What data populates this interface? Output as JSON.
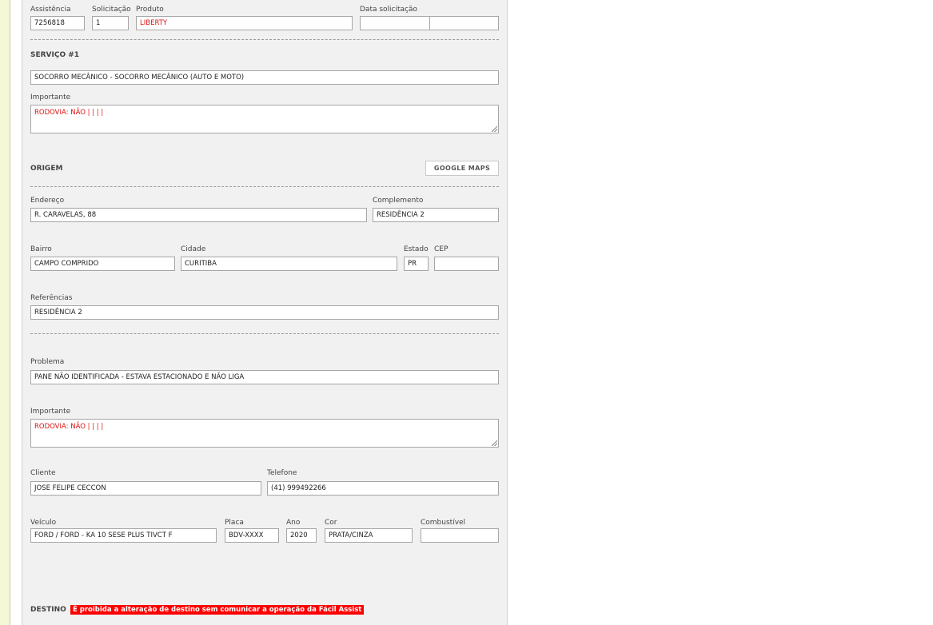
{
  "header_row": {
    "assistencia_label": "Assistência",
    "assistencia_value": "7256818",
    "solicitacao_label": "Solicitação",
    "solicitacao_value": "1",
    "produto_label": "Produto",
    "produto_value": "LIBERTY",
    "data_label": "Data solicitação"
  },
  "servico": {
    "title": "SERVIÇO #1",
    "service_value": "SOCORRO MECÂNICO - SOCORRO MECÂNICO (AUTO E MOTO)",
    "importante_label": "Importante",
    "importante_value": "RODOVIA: NÃO |  |  |  |"
  },
  "origem": {
    "title": "ORIGEM",
    "maps_button": "GOOGLE MAPS",
    "endereco_label": "Endereço",
    "endereco_value": "R. CARAVELAS, 88",
    "complemento_label": "Complemento",
    "complemento_value": "RESIDÊNCIA 2",
    "bairro_label": "Bairro",
    "bairro_value": "CAMPO COMPRIDO",
    "cidade_label": "Cidade",
    "cidade_value": "CURITIBA",
    "estado_label": "Estado",
    "estado_value": "PR",
    "cep_label": "CEP",
    "cep_value": "",
    "referencias_label": "Referências",
    "referencias_value": "RESIDÊNCIA 2"
  },
  "detalhes": {
    "problema_label": "Problema",
    "problema_value": "PANE NÃO IDENTIFICADA - ESTAVA ESTACIONADO E NÃO LIGA",
    "importante_label": "Importante",
    "importante_value": "RODOVIA: NÃO |  |  |  |",
    "cliente_label": "Cliente",
    "cliente_value": "JOSE FELIPE CECCON",
    "telefone_label": "Telefone",
    "telefone_value": "(41) 999492266",
    "veiculo_label": "Veículo",
    "veiculo_value": "FORD / FORD - KA 10 SESE PLUS TIVCT F",
    "placa_label": "Placa",
    "placa_value": "BDV-XXXX",
    "ano_label": "Ano",
    "ano_value": "2020",
    "cor_label": "Cor",
    "cor_value": "PRATA/CINZA",
    "combustivel_label": "Combustível",
    "combustivel_value": ""
  },
  "destino": {
    "title": "DESTINO",
    "warning": "É proibida a alteração de destino sem comunicar a operação da Fácil Assist"
  },
  "colors": {
    "accent_red": "#dd1111",
    "warning_bg": "#ff0000",
    "panel_bg": "#f1f1f1"
  }
}
